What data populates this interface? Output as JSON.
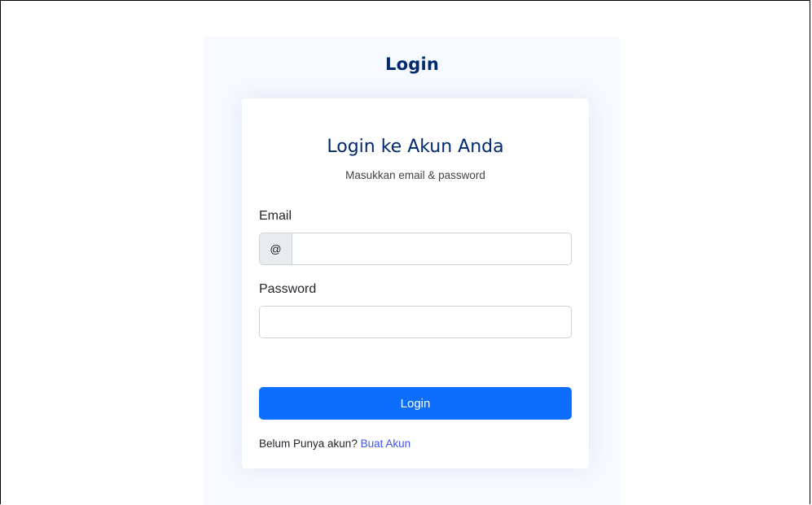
{
  "page": {
    "title": "Login"
  },
  "card": {
    "title": "Login ke Akun Anda",
    "subtitle": "Masukkan email & password"
  },
  "form": {
    "email_label": "Email",
    "email_addon": "@",
    "email_value": "",
    "password_label": "Password",
    "password_value": "",
    "submit_label": "Login"
  },
  "register": {
    "prompt": "Belum Punya akun?",
    "link_label": "Buat Akun"
  },
  "colors": {
    "primary": "#0d6efd",
    "heading": "#012970",
    "link": "#4154f1",
    "panel_background": "#f6f9ff"
  }
}
